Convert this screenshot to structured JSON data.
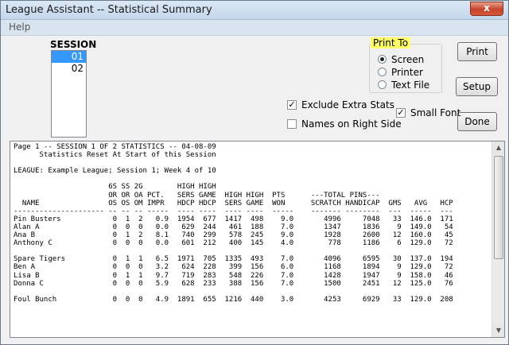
{
  "window": {
    "title": "League Assistant -- Statistical Summary",
    "close_glyph": "x"
  },
  "menu": {
    "items": [
      "Help"
    ]
  },
  "session": {
    "label": "SESSION",
    "items": [
      "01",
      "02"
    ],
    "selected_index": 0
  },
  "print_to": {
    "legend": "Print To",
    "options": [
      {
        "label": "Screen",
        "checked": true
      },
      {
        "label": "Printer",
        "checked": false
      },
      {
        "label": "Text File",
        "checked": false
      }
    ]
  },
  "buttons": {
    "print": "Print",
    "setup": "Setup",
    "done": "Done"
  },
  "options": {
    "exclude_extra_stats": {
      "label": "Exclude Extra Stats",
      "checked": true
    },
    "names_on_right_side": {
      "label": "Names on Right Side",
      "checked": false
    },
    "small_font": {
      "label": "Small Font",
      "checked": true
    }
  },
  "report": {
    "lines": [
      "Page 1 -- SESSION 1 OF 2 STATISTICS -- 04-08-09",
      "      Statistics Reset At Start of this Session",
      "",
      "LEAGUE: Example League; Session 1; Week 4 of 10",
      "",
      "                      6S SS 2G        HIGH HIGH",
      "                      OR OR OA PCT.   SERS GAME  HIGH HIGH  PTS      ---TOTAL PINS---",
      "  NAME                OS OS OM IMPR   HDCP HDCP  SERS GAME  WON      SCRATCH HANDICAP  GMS   AVG   HCP",
      "--------------------- -- -- -- -----  ---- ----  ---- ----  -----    ------- --------  ---  -----  ---",
      "Pin Busters            0  1  2   0.9  1954  677  1417  498    9.0       4996     7048   33  146.0  171",
      "Alan A                 0  0  0   0.0   629  244   461  188    7.0       1347     1836    9  149.0   54",
      "Ana B                  0  1  2   8.1   740  299   578  245    9.0       1928     2600   12  160.0   45",
      "Anthony C              0  0  0   0.0   601  212   400  145    4.0        778     1186    6  129.0   72",
      "",
      "Spare Tigers           0  1  1   6.5  1971  705  1335  493    7.0       4096     6595   30  137.0  194",
      "Ben A                  0  0  0   3.2   624  228   399  156    6.0       1168     1894    9  129.0   72",
      "Lisa B                 0  1  1   9.7   719  283   548  226    7.0       1428     1947    9  158.0   46",
      "Donna C                0  0  0   5.9   628  233   388  156    7.0       1500     2451   12  125.0   76",
      "",
      "Foul Bunch             0  0  0   4.9  1891  655  1216  440    3.0       4253     6929   33  129.0  208"
    ]
  },
  "scrollbar": {
    "up_glyph": "▲",
    "down_glyph": "▼"
  }
}
